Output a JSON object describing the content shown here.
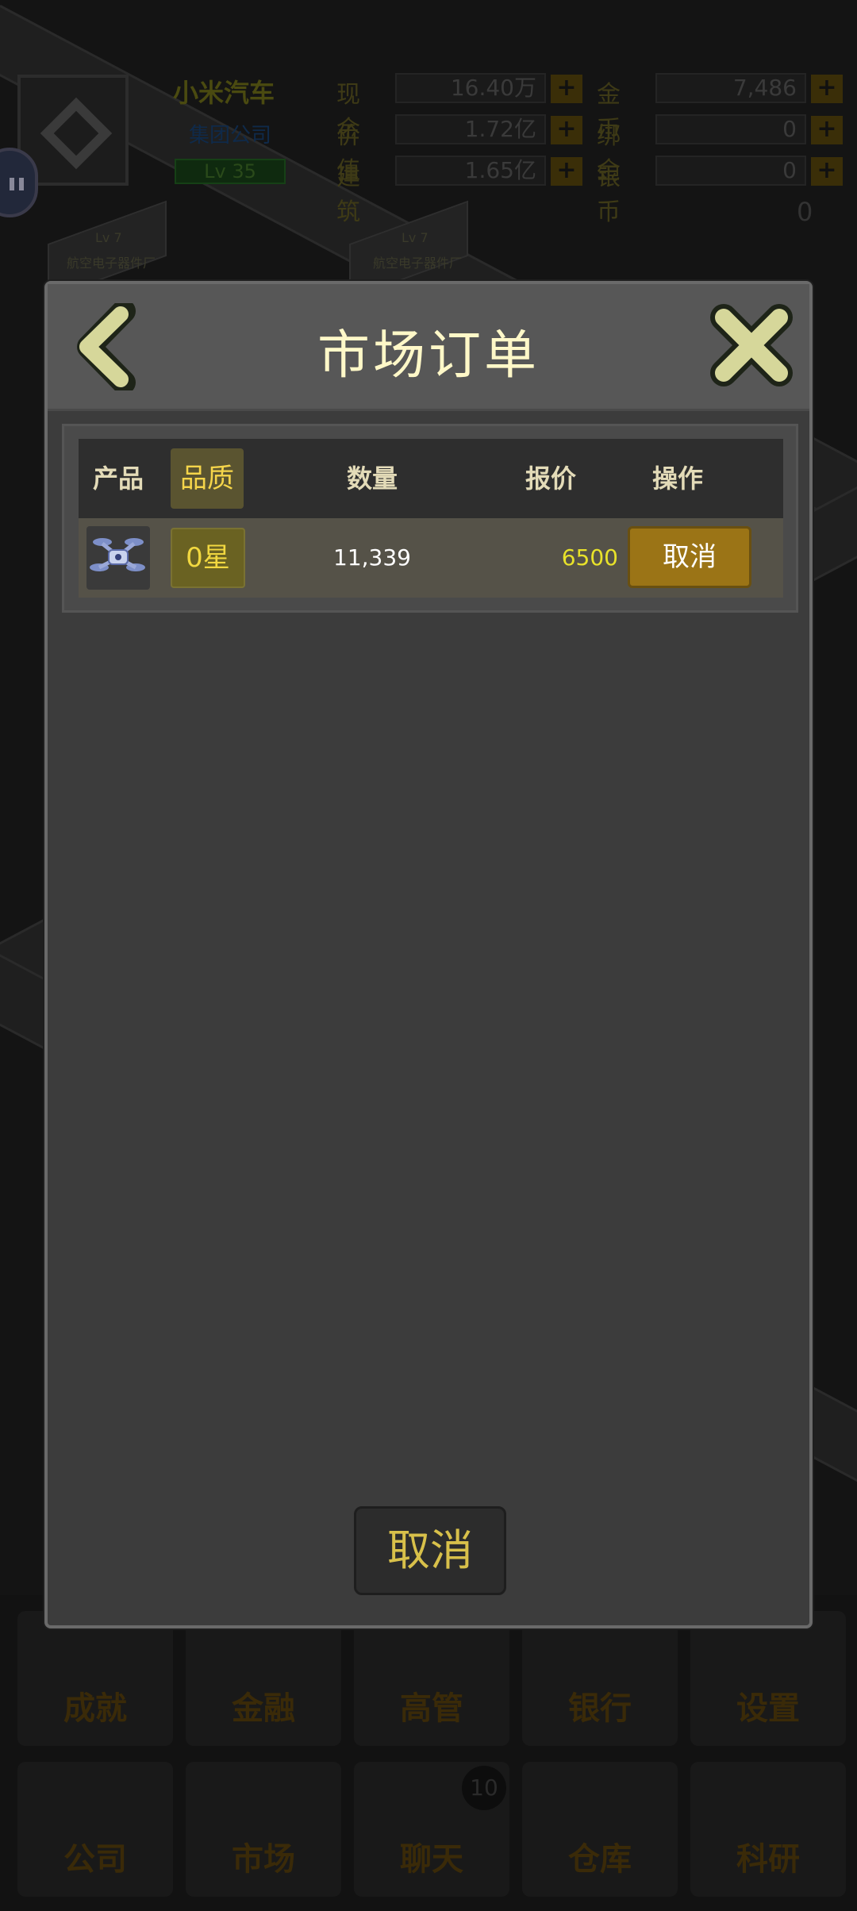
{
  "topbar": {
    "company_name": "小米汽车",
    "company_type": "集团公司",
    "level": "Lv 35",
    "stats": [
      {
        "label": "现金",
        "value": "16.40万"
      },
      {
        "label": "价值",
        "value": "1.72亿"
      },
      {
        "label": "建筑",
        "value": "1.65亿"
      },
      {
        "label": "金币",
        "value": "7,486"
      },
      {
        "label": "绑金",
        "value": "0"
      },
      {
        "label": "银币",
        "value": "0"
      }
    ],
    "plus_label": "+",
    "counter": "0"
  },
  "scene_labels": [
    "Lv 7",
    "航空电子器件厂",
    "Lv 7",
    "航空电子器件厂"
  ],
  "modal": {
    "title": "市场订单",
    "columns": {
      "product": "产品",
      "quality": "品质",
      "quantity": "数量",
      "price": "报价",
      "action": "操作"
    },
    "rows": [
      {
        "product_icon": "drone-icon",
        "quality": "0星",
        "quantity": "11,339",
        "price": "6500",
        "action": "取消"
      }
    ],
    "footer_button": "取消"
  },
  "bottom_nav": {
    "row1": [
      "成就",
      "金融",
      "高管",
      "银行",
      "设置"
    ],
    "row2": [
      "公司",
      "市场",
      "聊天",
      "仓库",
      "科研"
    ],
    "chat_badge": "10"
  },
  "colors": {
    "title": "#fff8c8",
    "accent_gold": "#9b7416",
    "price": "#e8e22a",
    "quality": "#f2d840"
  }
}
